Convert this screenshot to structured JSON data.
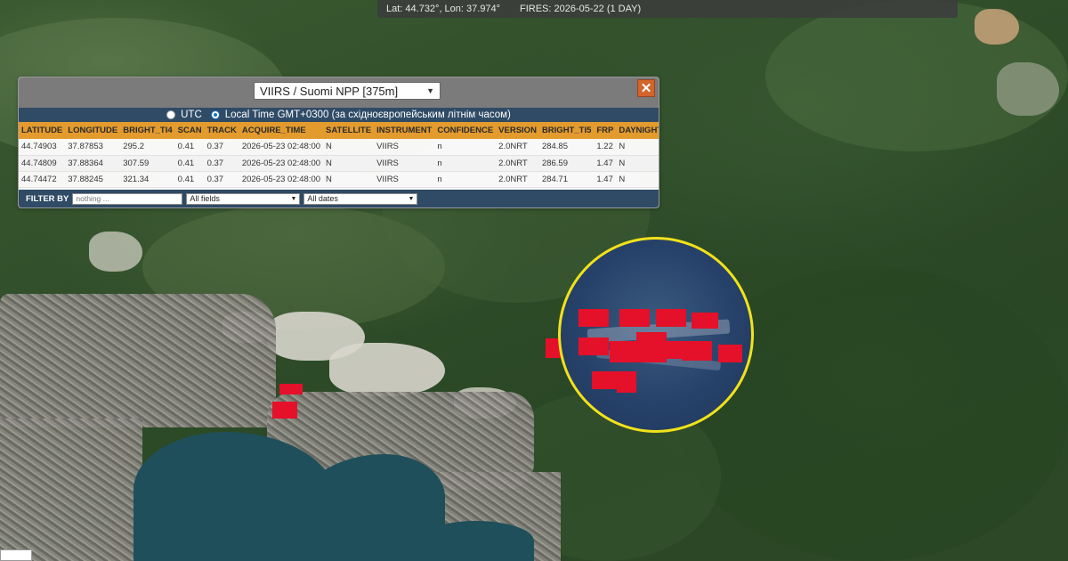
{
  "status_bar": {
    "coords": "Lat: 44.732°, Lon: 37.974°",
    "fires": "FIRES: 2026-05-22 (1 DAY)"
  },
  "panel": {
    "satellite_selected": "VIIRS / Suomi NPP [375m]",
    "close_label": "✕",
    "tz_utc_label": "UTC",
    "tz_local_label": "Local Time GMT+0300 (за східноєвропейським літнім часом)",
    "tz_selected": "local",
    "columns": [
      "LATITUDE",
      "LONGITUDE",
      "BRIGHT_TI4",
      "SCAN",
      "TRACK",
      "ACQUIRE_TIME",
      "SATELLITE",
      "INSTRUMENT",
      "CONFIDENCE",
      "VERSION",
      "BRIGHT_TI5",
      "FRP",
      "DAYNIGHT"
    ],
    "rows": [
      [
        "44.74903",
        "37.87853",
        "295.2",
        "0.41",
        "0.37",
        "2026-05-23 02:48:00",
        "N",
        "VIIRS",
        "n",
        "2.0NRT",
        "284.85",
        "1.22",
        "N"
      ],
      [
        "44.74809",
        "37.88364",
        "307.59",
        "0.41",
        "0.37",
        "2026-05-23 02:48:00",
        "N",
        "VIIRS",
        "n",
        "2.0NRT",
        "286.59",
        "1.47",
        "N"
      ],
      [
        "44.74472",
        "37.88245",
        "321.34",
        "0.41",
        "0.37",
        "2026-05-23 02:48:00",
        "N",
        "VIIRS",
        "n",
        "2.0NRT",
        "284.71",
        "1.47",
        "N"
      ]
    ],
    "filter": {
      "label": "FILTER BY",
      "placeholder": "nothing ...",
      "field_selected": "All fields",
      "date_selected": "All dates"
    }
  },
  "colors": {
    "fire": "#e5102a",
    "highlight_circle": "#f2e21a",
    "header_orange": "#e39b2e",
    "panel_blue": "#2f4b66",
    "close_orange": "#d1652a"
  },
  "icons": {
    "close": "close-icon",
    "dropdown": "chevron-down-icon"
  }
}
